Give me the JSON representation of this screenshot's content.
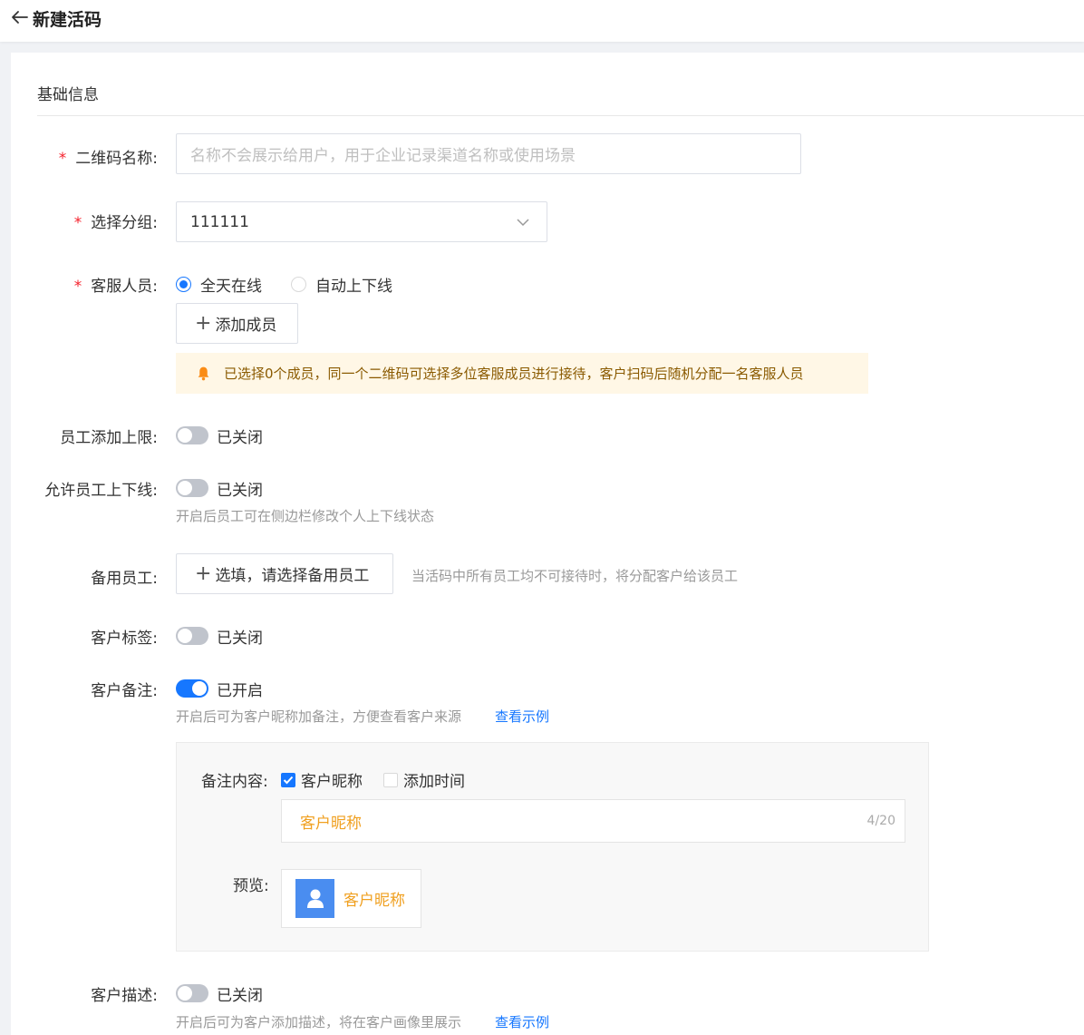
{
  "header": {
    "title": "新建活码",
    "back_icon": "arrow-left-icon"
  },
  "section": {
    "title": "基础信息"
  },
  "qr_name": {
    "label": "二维码名称:",
    "required_mark": "*",
    "placeholder": "名称不会展示给用户，用于企业记录渠道名称或使用场景"
  },
  "group": {
    "label": "选择分组:",
    "required_mark": "*",
    "value": "111111"
  },
  "service_staff": {
    "label": "客服人员:",
    "required_mark": "*",
    "options": [
      {
        "label": "全天在线",
        "selected": true
      },
      {
        "label": "自动上下线",
        "selected": false
      }
    ],
    "add_button": "添加成员",
    "notice": "已选择0个成员，同一个二维码可选择多位客服成员进行接待，客户扫码后随机分配一名客服人员"
  },
  "staff_limit": {
    "label": "员工添加上限:",
    "status": "已关闭",
    "enabled": false
  },
  "staff_online": {
    "label": "允许员工上下线:",
    "status": "已关闭",
    "enabled": false,
    "hint": "开启后员工可在侧边栏修改个人上下线状态"
  },
  "backup_staff": {
    "label": "备用员工:",
    "button": "选填，请选择备用员工",
    "hint": "当活码中所有员工均不可接待时，将分配客户给该员工"
  },
  "customer_tags": {
    "label": "客户标签:",
    "status": "已关闭",
    "enabled": false
  },
  "customer_remark": {
    "label": "客户备注:",
    "status": "已开启",
    "enabled": true,
    "hint": "开启后可为客户昵称加备注，方便查看客户来源",
    "example_link": "查看示例",
    "content_label": "备注内容:",
    "checkboxes": [
      {
        "label": "客户昵称",
        "checked": true
      },
      {
        "label": "添加时间",
        "checked": false
      }
    ],
    "input_value": "客户昵称",
    "counter": "4/20",
    "preview_label": "预览:",
    "preview_name": "客户昵称"
  },
  "customer_desc": {
    "label": "客户描述:",
    "status": "已关闭",
    "enabled": false,
    "hint": "开启后可为客户添加描述，将在客户画像里展示",
    "example_link": "查看示例"
  },
  "colors": {
    "primary": "#1677ff",
    "required": "#f5222d",
    "nickname": "#f0a020",
    "notice_bg": "#fff7e6"
  }
}
